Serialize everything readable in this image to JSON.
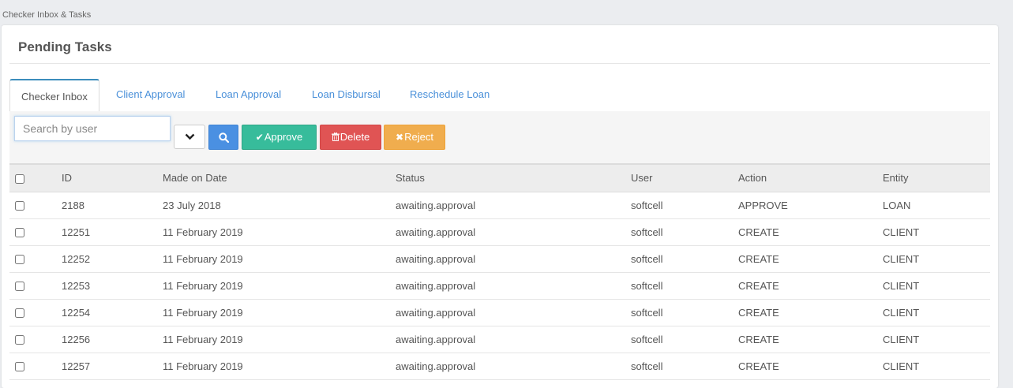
{
  "breadcrumb": "Checker Inbox & Tasks",
  "panel": {
    "title": "Pending Tasks"
  },
  "tabs": [
    {
      "label": "Checker Inbox",
      "active": true
    },
    {
      "label": "Client Approval",
      "active": false
    },
    {
      "label": "Loan Approval",
      "active": false
    },
    {
      "label": "Loan Disbursal",
      "active": false
    },
    {
      "label": "Reschedule Loan",
      "active": false
    }
  ],
  "toolbar": {
    "search_placeholder": "Search by user",
    "approve_label": "Approve",
    "delete_label": "Delete",
    "reject_label": "Reject"
  },
  "colors": {
    "search_button": "#4a90e2",
    "approve_button": "#37bc9b",
    "delete_button": "#e05454",
    "reject_button": "#f0ad4e",
    "tab_link": "#4a90d9"
  },
  "table": {
    "columns": [
      "ID",
      "Made on Date",
      "Status",
      "User",
      "Action",
      "Entity"
    ],
    "rows": [
      [
        "2188",
        "23 July 2018",
        "awaiting.approval",
        "softcell",
        "APPROVE",
        "LOAN"
      ],
      [
        "12251",
        "11 February 2019",
        "awaiting.approval",
        "softcell",
        "CREATE",
        "CLIENT"
      ],
      [
        "12252",
        "11 February 2019",
        "awaiting.approval",
        "softcell",
        "CREATE",
        "CLIENT"
      ],
      [
        "12253",
        "11 February 2019",
        "awaiting.approval",
        "softcell",
        "CREATE",
        "CLIENT"
      ],
      [
        "12254",
        "11 February 2019",
        "awaiting.approval",
        "softcell",
        "CREATE",
        "CLIENT"
      ],
      [
        "12256",
        "11 February 2019",
        "awaiting.approval",
        "softcell",
        "CREATE",
        "CLIENT"
      ],
      [
        "12257",
        "11 February 2019",
        "awaiting.approval",
        "softcell",
        "CREATE",
        "CLIENT"
      ]
    ]
  }
}
